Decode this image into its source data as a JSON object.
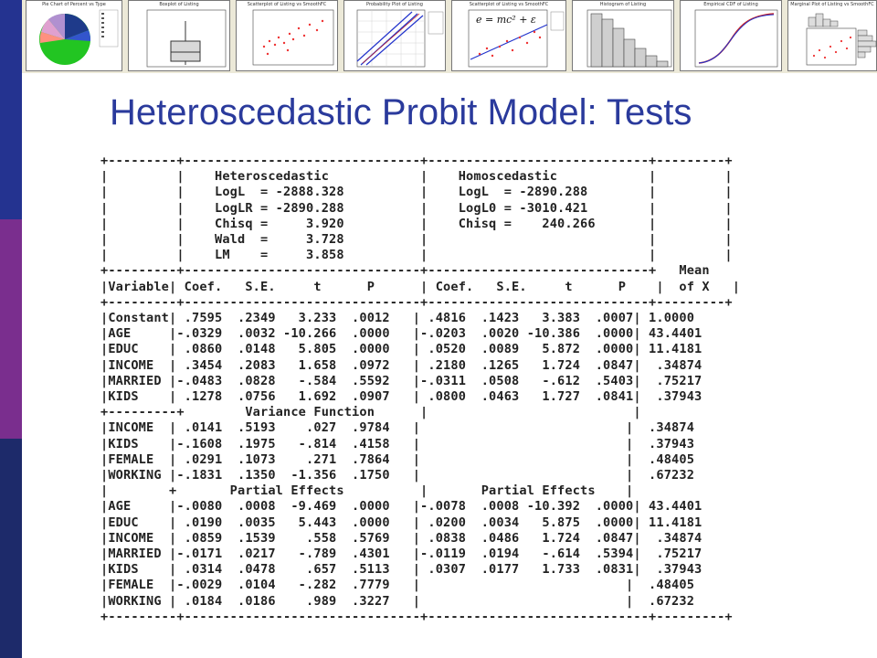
{
  "slide": {
    "title": "Heteroscedastic Probit Model: Tests",
    "sidebar_colors": [
      "#243390",
      "#7a2e8e",
      "#1d2a6a"
    ]
  },
  "thumbnails": [
    {
      "title": "Pie Chart of Percent vs Type",
      "kind": "pie-chart-icon"
    },
    {
      "title": "Boxplot of Listing",
      "kind": "boxplot-icon"
    },
    {
      "title": "Scatterplot of Listing vs SmoothFC",
      "kind": "scatter-icon"
    },
    {
      "title": "Probability Plot of Listing",
      "kind": "probability-plot-icon"
    },
    {
      "title": "Scatterplot of Listing vs SmoothFC",
      "kind": "scatter-fit-icon",
      "formula": "e = mc² + ε"
    },
    {
      "title": "Histogram of Listing",
      "kind": "histogram-icon"
    },
    {
      "title": "Empirical CDF of Listing",
      "kind": "cdf-icon"
    },
    {
      "title": "Marginal Plot of Listing vs SmoothFC",
      "kind": "marginal-plot-icon"
    }
  ],
  "output_lines": [
    "+---------+-------------------------------+-----------------------------+---------+",
    "|         |    Heteroscedastic            |    Homoscedastic            |         |",
    "|         |    LogL  = -2888.328          |    LogL  = -2890.288        |         |",
    "|         |    LogLR = -2890.288          |    LogL0 = -3010.421        |         |",
    "|         |    Chisq =     3.920          |    Chisq =    240.266       |         |",
    "|         |    Wald  =     3.728          |                             |         |",
    "|         |    LM    =     3.858          |                             |         |",
    "+---------+-------------------------------+-----------------------------+   Mean  ",
    "|Variable| Coef.   S.E.     t      P      | Coef.   S.E.     t      P    |  of X   |",
    "+---------+-------------------------------+-----------------------------+---------+",
    "|Constant| .7595  .2349   3.233  .0012   | .4816  .1423   3.383  .0007| 1.0000  ",
    "|AGE     |-.0329  .0032 -10.266  .0000   |-.0203  .0020 -10.386  .0000| 43.4401 ",
    "|EDUC    | .0860  .0148   5.805  .0000   | .0520  .0089   5.872  .0000| 11.4181 ",
    "|INCOME  | .3454  .2083   1.658  .0972   | .2180  .1265   1.724  .0847|  .34874 ",
    "|MARRIED |-.0483  .0828   -.584  .5592   |-.0311  .0508   -.612  .5403|  .75217 ",
    "|KIDS    | .1278  .0756   1.692  .0907   | .0800  .0463   1.727  .0841|  .37943 ",
    "+---------+        Variance Function      |                           |         ",
    "|INCOME  | .0141  .5193    .027  .9784   |                           |  .34874 ",
    "|KIDS    |-.1608  .1975   -.814  .4158   |                           |  .37943 ",
    "|FEMALE  | .0291  .1073    .271  .7864   |                           |  .48405 ",
    "|WORKING |-.1831  .1350  -1.356  .1750   |                           |  .67232 ",
    "|        +       Partial Effects          |       Partial Effects    |         ",
    "|AGE     |-.0080  .0008  -9.469  .0000   |-.0078  .0008 -10.392  .0000| 43.4401 ",
    "|EDUC    | .0190  .0035   5.443  .0000   | .0200  .0034   5.875  .0000| 11.4181 ",
    "|INCOME  | .0859  .1539    .558  .5769   | .0838  .0486   1.724  .0847|  .34874 ",
    "|MARRIED |-.0171  .0217   -.789  .4301   |-.0119  .0194   -.614  .5394|  .75217 ",
    "|KIDS    | .0314  .0478    .657  .5113   | .0307  .0177   1.733  .0831|  .37943 ",
    "|FEMALE  |-.0029  .0104   -.282  .7779   |                           |  .48405 ",
    "|WORKING | .0184  .0186    .989  .3227   |                           |  .67232 ",
    "+---------+-------------------------------+-----------------------------+---------+"
  ]
}
